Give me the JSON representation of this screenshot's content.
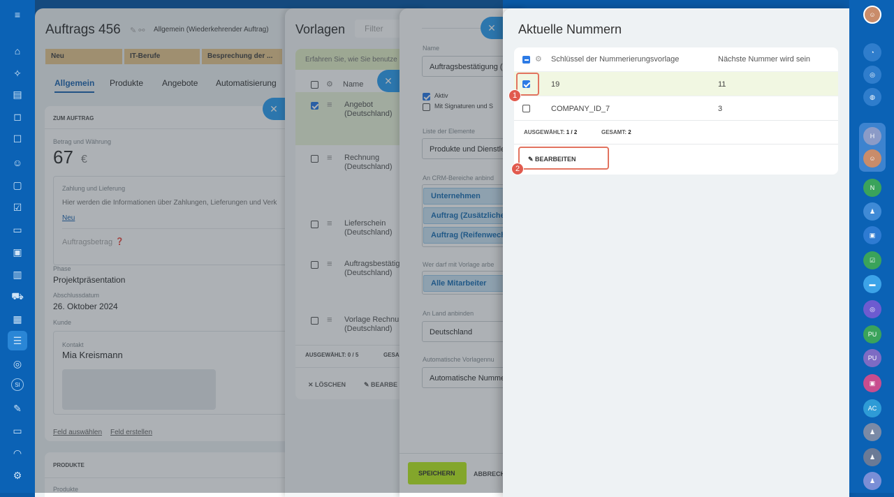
{
  "leftbar": {
    "icons": [
      "menu-icon",
      "home-icon",
      "sparkle-icon",
      "document-icon",
      "chat-icon",
      "tasks-icon",
      "contacts-icon",
      "file-icon",
      "checklist-icon",
      "inbox-icon",
      "monitor-icon",
      "chart-icon",
      "cart-icon",
      "calendar-icon",
      "filter-icon",
      "target-icon",
      "si",
      "sign-icon",
      "id-card-icon",
      "headset-icon",
      "settings-icon"
    ],
    "si_label": "SI"
  },
  "deal": {
    "title": "Auftrags 456",
    "category": "Allgemein (Wiederkehrender Auftrag)",
    "stages": [
      "Neu",
      "IT-Berufe",
      "Besprechung der ..."
    ],
    "tabs": [
      "Allgemein",
      "Produkte",
      "Angebote",
      "Automatisierung"
    ],
    "section_title": "ZUM AUFTRAG",
    "amount_label": "Betrag und Währung",
    "amount": "67",
    "currency": "€",
    "payment_label": "Zahlung und Lieferung",
    "payment_text": "Hier werden die Informationen über Zahlungen, Lieferungen und Verk",
    "new_link": "Neu",
    "order_amount_label": "Auftragsbetrag",
    "phase_label": "Phase",
    "phase": "Projektpräsentation",
    "close_date_label": "Abschlussdatum",
    "close_date": "26. Oktober 2024",
    "client_label": "Kunde",
    "contact_label": "Kontakt",
    "contact": "Mia Kreismann",
    "field_select": "Feld auswählen",
    "field_create": "Feld erstellen",
    "products_section": "PRODUKTE",
    "products_label": "Produkte"
  },
  "templates": {
    "title": "Vorlagen",
    "filter_placeholder": "Filter",
    "info": "Erfahren Sie, wie Sie benutze",
    "col_name": "Name",
    "items": [
      {
        "name": "Angebot (Deutschland)",
        "checked": true
      },
      {
        "name": "Rechnung (Deutschland)",
        "checked": false
      },
      {
        "name": "Lieferschein (Deutschland)",
        "checked": false
      },
      {
        "name": "Auftragsbestätig (Deutschland)",
        "checked": false
      },
      {
        "name": "Vorlage Rechnu (Deutschland)",
        "checked": false
      }
    ],
    "selected": "AUSGEWÄHLT: 0 / 5",
    "total": "GESA",
    "delete": "LÖSCHEN",
    "edit": "BEARBE"
  },
  "form": {
    "name_label": "Name",
    "name_value": "Auftragsbestätigung (",
    "active": "Aktiv",
    "with_signatures": "Mit Signaturen und S",
    "elements_label": "Liste der Elemente",
    "elements_value": "Produkte und Dienstle",
    "crm_label": "An CRM-Bereiche anbind",
    "crm_tags": [
      "Unternehmen",
      "Auftrag (Zusätzliche",
      "Auftrag (Reifenwech"
    ],
    "who_label": "Wer darf mit Vorlage arbe",
    "who_value": "Alle Mitarbeiter",
    "country_label": "An Land anbinden",
    "country_value": "Deutschland",
    "numbering_label": "Automatische Vorlagennu",
    "numbering_value": "Automatische Numme",
    "save": "SPEICHERN",
    "cancel": "ABBRECH"
  },
  "numbers": {
    "title": "Aktuelle Nummern",
    "col_key": "Schlüssel der Nummerierungsvorlage",
    "col_next": "Nächste Nummer wird sein",
    "rows": [
      {
        "key": "19",
        "next": "11",
        "checked": true
      },
      {
        "key": "COMPANY_ID_7",
        "next": "3",
        "checked": false
      }
    ],
    "selected_label": "AUSGEWÄHLT:",
    "selected_value": "1 / 2",
    "total_label": "GESAMT:",
    "total_value": "2",
    "edit": "BEARBEITEN",
    "callouts": [
      "1",
      "2"
    ]
  },
  "rightbar": {
    "avatars": [
      "N",
      "PU",
      "PU",
      "AC"
    ],
    "group_label": "H"
  }
}
